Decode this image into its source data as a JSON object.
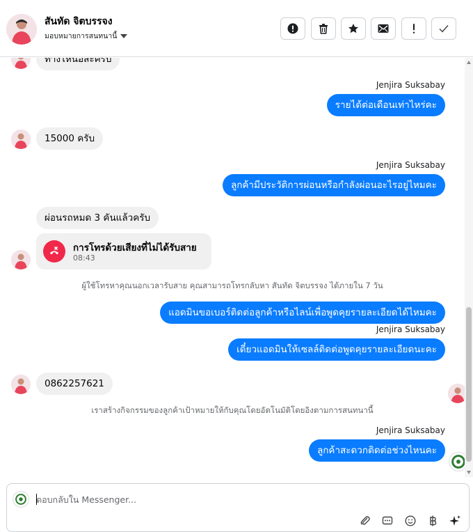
{
  "header": {
    "contact_name": "สันทัด จิตบรรจง",
    "assign_label": "มอบหมายการสนทนานี้",
    "tools": [
      {
        "name": "mark-spam-button",
        "icon": "exclamation-circle-icon"
      },
      {
        "name": "delete-button",
        "icon": "trash-icon"
      },
      {
        "name": "star-button",
        "icon": "star-icon"
      },
      {
        "name": "mark-unread-button",
        "icon": "envelope-icon"
      },
      {
        "name": "follow-up-button",
        "icon": "exclamation-icon"
      },
      {
        "name": "mark-done-button",
        "icon": "check-icon"
      }
    ]
  },
  "messages": {
    "partial_top": "ทางไหนอีสะครับ",
    "sender_name": "Jenjira Suksabay",
    "out_1": "รายได้ต่อเดือนเท่าไหร่คะ",
    "in_1": "15000 ครับ",
    "out_2": "ลูกค้ามีประวัติการผ่อนหรือกำลังผ่อนอะไรอยู่ไหมคะ",
    "in_2": "ผ่อนรถหมด 3 คันแล้วครับ",
    "call_title": "การโทรด้วยเสียงที่ไม่ได้รับสาย",
    "call_time": "08:43",
    "system_1": "ผู้ใช้โทรหาคุณนอกเวลารับสาย คุณสามารถโทรกลับหา สันทัด จิตบรรจง ได้ภายใน 7 วัน",
    "out_3": "แอดมินขอเบอร์ติดต่อลูกค้าหรือไลน์เพื่อพูดคุยรายละเอียดได้ไหมคะ",
    "out_4": "เดี๋ยวแอดมินให้เซลล์ติดต่อพูดคุยรายละเอียดนะคะ",
    "in_3": "0862257621",
    "system_2": "เราสร้างกิจกรรมของลูกค้าเป้าหมายให้กับคุณโดยอัตโนมัติโดยอิงตามการสนทนานี้",
    "out_5": "ลูกค้าสะดวกติดต่อช่วงไหนคะ"
  },
  "composer": {
    "placeholder": "ตอบกลับใน Messenger...",
    "tools": [
      "paperclip-icon",
      "saved-reply-icon",
      "emoji-icon",
      "currency-icon",
      "sparkle-icon"
    ]
  },
  "colors": {
    "outgoing_bubble": "#0a7cff",
    "incoming_bubble": "#f0f0f0",
    "missed_call": "#f02849"
  }
}
